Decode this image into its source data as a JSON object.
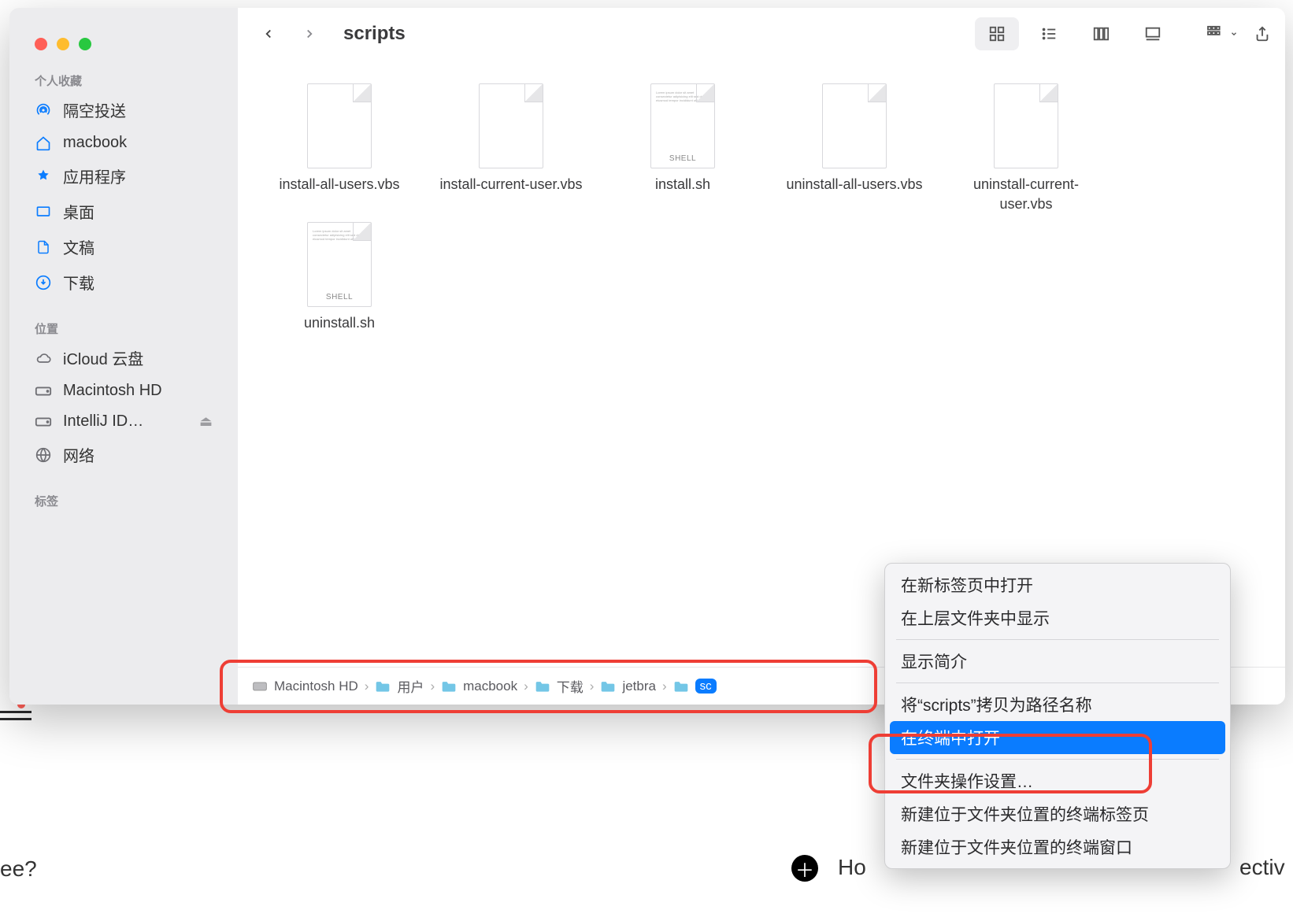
{
  "window": {
    "title": "scripts"
  },
  "traffic_lights": {
    "close": "close",
    "min": "minimize",
    "max": "fullscreen"
  },
  "sidebar": {
    "sections": {
      "favorites_header": "个人收藏",
      "locations_header": "位置",
      "tags_header": "标签"
    },
    "favorites": [
      {
        "icon": "airdrop",
        "label": "隔空投送"
      },
      {
        "icon": "home",
        "label": "macbook"
      },
      {
        "icon": "apps",
        "label": "应用程序"
      },
      {
        "icon": "desktop",
        "label": "桌面"
      },
      {
        "icon": "doc",
        "label": "文稿"
      },
      {
        "icon": "download",
        "label": "下载"
      }
    ],
    "locations": [
      {
        "icon": "cloud",
        "label": "iCloud 云盘"
      },
      {
        "icon": "disk",
        "label": "Macintosh HD"
      },
      {
        "icon": "disk",
        "label": "IntelliJ ID…",
        "eject": true
      },
      {
        "icon": "globe",
        "label": "网络"
      }
    ]
  },
  "toolbar": {
    "back": "back",
    "forward": "forward",
    "views": {
      "icon": "icon-view",
      "list": "list-view",
      "column": "column-view",
      "gallery": "gallery-view"
    },
    "group": "group-by",
    "share": "share"
  },
  "files": [
    {
      "name": "install-all-users.vbs",
      "preview": "plain"
    },
    {
      "name": "install-current-user.vbs",
      "preview": "plain"
    },
    {
      "name": "install.sh",
      "preview": "text",
      "badge": "SHELL"
    },
    {
      "name": "uninstall-all-users.vbs",
      "preview": "plain"
    },
    {
      "name": "uninstall-current-user.vbs",
      "preview": "plain"
    },
    {
      "name": "uninstall.sh",
      "preview": "text",
      "badge": "SHELL"
    }
  ],
  "path": [
    {
      "icon": "hdd",
      "label": "Macintosh HD"
    },
    {
      "icon": "folder",
      "label": "用户"
    },
    {
      "icon": "folder",
      "label": "macbook"
    },
    {
      "icon": "folder",
      "label": "下载"
    },
    {
      "icon": "folder",
      "label": "jetbra"
    },
    {
      "icon": "folder",
      "label": "sc",
      "selected": true
    }
  ],
  "context_menu": [
    {
      "label": "在新标签页中打开"
    },
    {
      "label": "在上层文件夹中显示"
    },
    {
      "type": "sep"
    },
    {
      "label": "显示简介"
    },
    {
      "type": "sep"
    },
    {
      "label": "将“scripts”拷贝为路径名称"
    },
    {
      "label": "在终端中打开",
      "highlight": true
    },
    {
      "type": "sep"
    },
    {
      "label": "文件夹操作设置…"
    },
    {
      "label": "新建位于文件夹位置的终端标签页"
    },
    {
      "label": "新建位于文件夹位置的终端窗口"
    }
  ],
  "background": {
    "frag_left": "ee?",
    "frag_how": "Ho",
    "frag_ectiv": "ectiv"
  }
}
